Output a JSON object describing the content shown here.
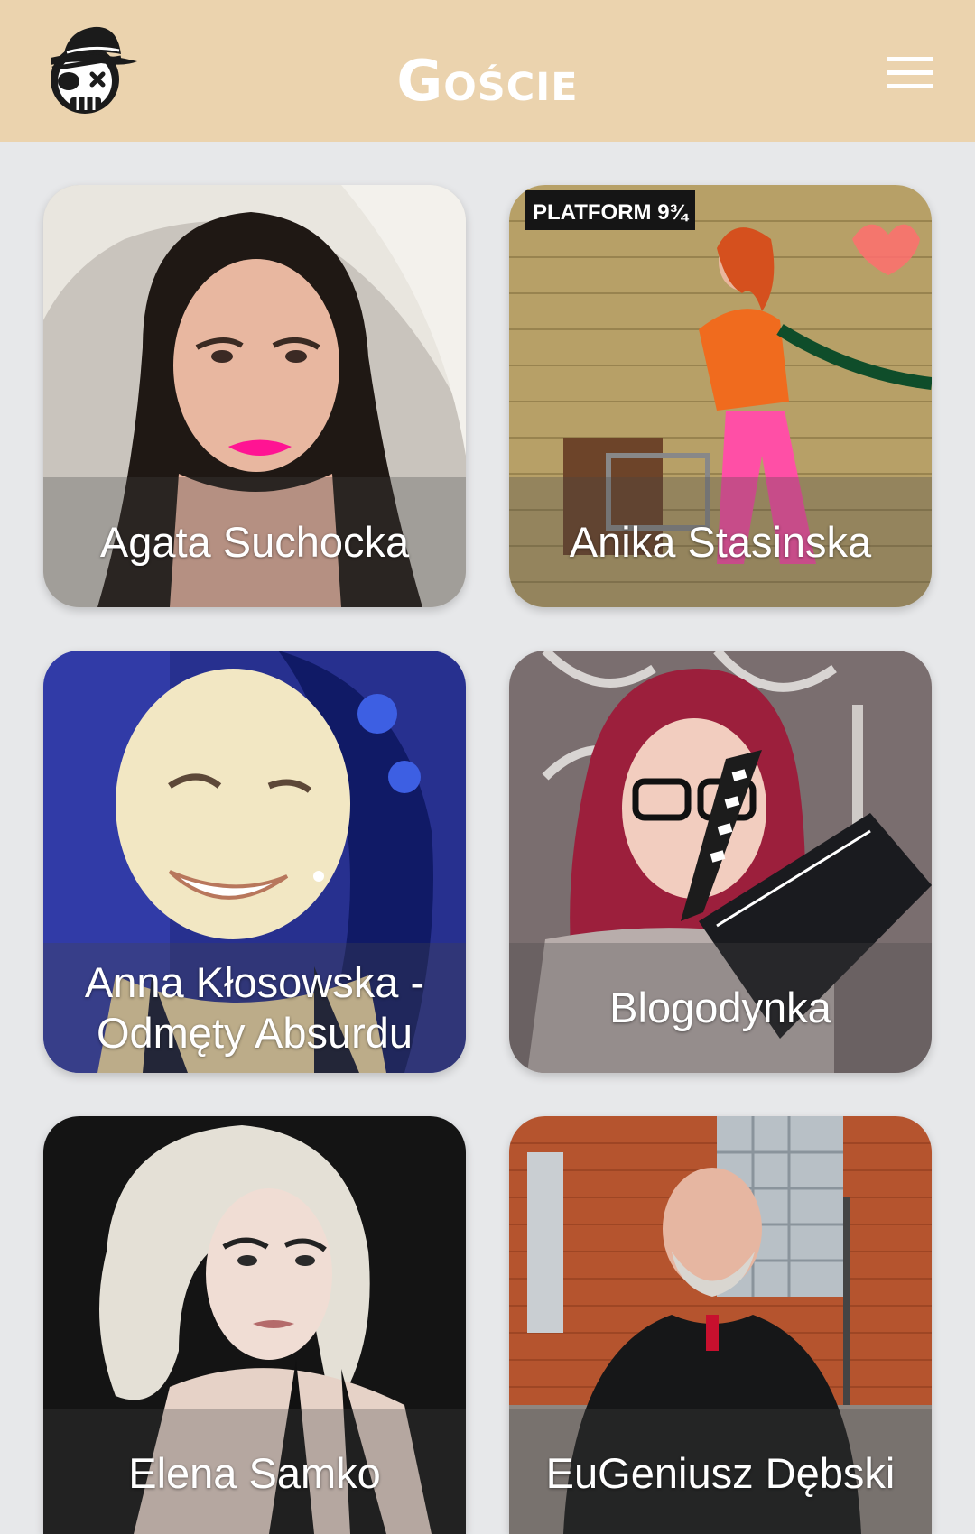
{
  "header": {
    "title": "Goście",
    "logo_icon": "skull-pirate-hat-icon",
    "menu_icon": "hamburger-menu-icon",
    "background": "#ebd3ae"
  },
  "guests": [
    {
      "name": "Agata Suchocka"
    },
    {
      "name": "Anika Stasinska"
    },
    {
      "name": "Anna Kłosowska - Odmęty Absurdu"
    },
    {
      "name": "Blogodynka"
    },
    {
      "name": "Elena Samko"
    },
    {
      "name": "EuGeniusz Dębski"
    }
  ],
  "photo_labels": {
    "platform_sign": "PLATFORM 9¾"
  },
  "colors": {
    "page_bg": "#e7e8ea",
    "title": "#ffffff"
  }
}
